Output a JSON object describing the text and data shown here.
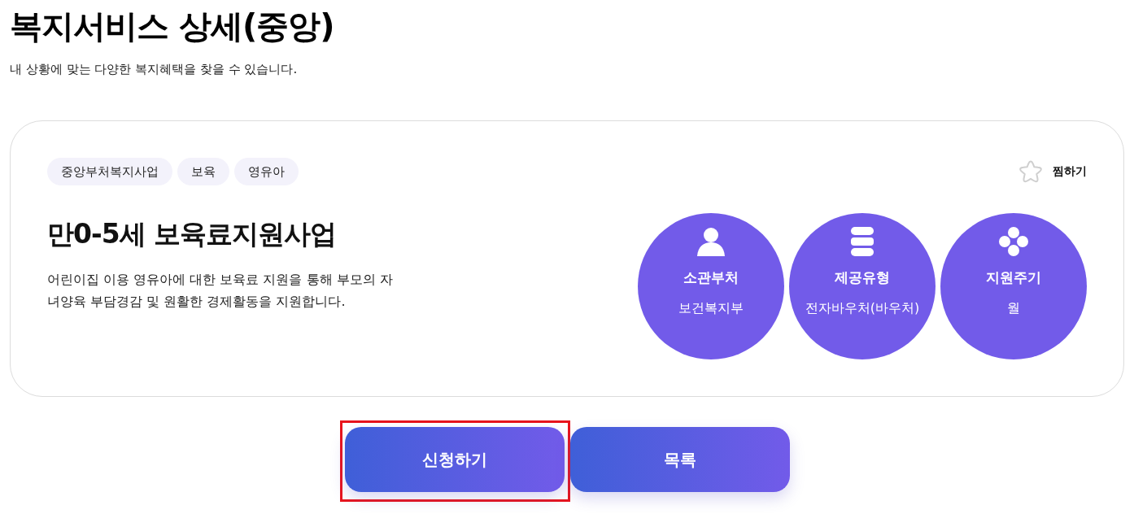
{
  "page": {
    "title": "복지서비스 상세(중앙)",
    "subtitle": "내 상황에 맞는 다양한 복지혜택을 찾을 수 있습니다."
  },
  "service": {
    "tags": [
      "중앙부처복지사업",
      "보육",
      "영유아"
    ],
    "favorite": {
      "label": "찜하기",
      "checked": false
    },
    "name": "만0-5세 보육료지원사업",
    "description": "어린이집 이용 영유아에 대한 보육료 지원을 통해 부모의 자녀양육 부담경감 및 원활한 경제활동을 지원합니다.",
    "info": [
      {
        "label": "소관부처",
        "value": "보건복지부"
      },
      {
        "label": "제공유형",
        "value": "전자바우처(바우처)"
      },
      {
        "label": "지원주기",
        "value": "월"
      }
    ]
  },
  "buttons": [
    {
      "label": "신청하기",
      "highlighted": true
    },
    {
      "label": "목록",
      "highlighted": false
    }
  ]
}
